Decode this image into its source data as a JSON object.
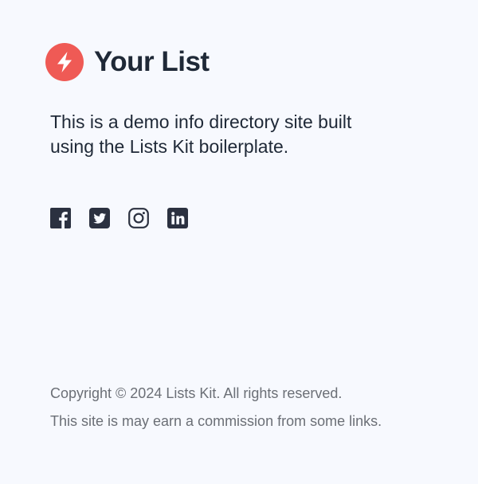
{
  "brand": {
    "name": "Your List",
    "logo_icon": "lightning-bolt-icon",
    "logo_color": "#ef5a55"
  },
  "tagline": "This is a demo info directory site built using the Lists Kit boilerplate.",
  "social": [
    {
      "network": "facebook",
      "icon": "facebook-icon"
    },
    {
      "network": "twitter",
      "icon": "twitter-icon"
    },
    {
      "network": "instagram",
      "icon": "instagram-icon"
    },
    {
      "network": "linkedin",
      "icon": "linkedin-icon"
    }
  ],
  "footer": {
    "copyright": "Copyright © 2024 Lists Kit. All rights reserved.",
    "disclaimer": "This site is may earn a commission from some links."
  },
  "colors": {
    "background": "#f7f9fe",
    "text_dark": "#1f2937",
    "text_muted": "#6b6f76",
    "icon": "#2b3140"
  }
}
